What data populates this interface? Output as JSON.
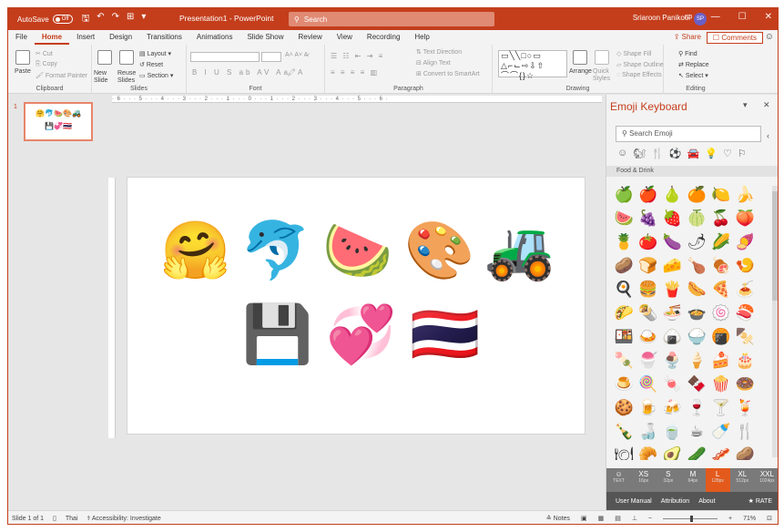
{
  "titlebar": {
    "autosave_label": "AutoSave",
    "autosave_state": "Off",
    "doc_title": "Presentation1 - PowerPoint",
    "search_placeholder": "Search",
    "user_name": "Sriaroon Panikool",
    "user_initials": "SP"
  },
  "tabs": [
    "File",
    "Home",
    "Insert",
    "Design",
    "Transitions",
    "Animations",
    "Slide Show",
    "Review",
    "View",
    "Recording",
    "Help"
  ],
  "active_tab": "Home",
  "share_label": "Share",
  "comments_label": "Comments",
  "ribbon": {
    "clipboard": {
      "label": "Clipboard",
      "paste": "Paste",
      "cut": "Cut",
      "copy": "Copy",
      "format_painter": "Format Painter"
    },
    "slides": {
      "label": "Slides",
      "new_slide": "New Slide",
      "reuse_slides": "Reuse Slides",
      "layout": "Layout",
      "reset": "Reset",
      "section": "Section"
    },
    "font": {
      "label": "Font"
    },
    "paragraph": {
      "label": "Paragraph",
      "text_direction": "Text Direction",
      "align_text": "Align Text",
      "convert_smartart": "Convert to SmartArt"
    },
    "drawing": {
      "label": "Drawing",
      "arrange": "Arrange",
      "quick_styles": "Quick Styles",
      "shape_fill": "Shape Fill",
      "shape_outline": "Shape Outline",
      "shape_effects": "Shape Effects"
    },
    "editing": {
      "label": "Editing",
      "find": "Find",
      "replace": "Replace",
      "select": "Select"
    }
  },
  "thumbnail": {
    "number": "1",
    "row1": "🤗🐬🍉🎨🚜",
    "row2": "💾💞🇹🇭"
  },
  "ruler_text": "· 6 · · · 5 · · · 4 · · · 3 · · · 2 · · · 1 · · · 0 · · · 1 · · · 2 · · · 3 · · · 4 · · · 5 · · · 6 ·",
  "slide_emojis": {
    "hugging": "🤗",
    "dolphin": "🐬",
    "watermelon": "🍉",
    "palette": "🎨",
    "tractor": "🚜",
    "floppy": "💾",
    "hearts": "💞",
    "flag": "🇹🇭"
  },
  "emoji_panel": {
    "title": "Emoji Keyboard",
    "search_placeholder": "Search Emoji",
    "category_icons": [
      "☺",
      "🐿",
      "🍴",
      "⚽",
      "🚘",
      "💡",
      "♡",
      "⚐"
    ],
    "category_label": "Food & Drink",
    "emojis": [
      "🍏",
      "🍎",
      "🍐",
      "🍊",
      "🍋",
      "🍌",
      "🍉",
      "🍇",
      "🍓",
      "🍈",
      "🍒",
      "🍑",
      "🍍",
      "🍅",
      "🍆",
      "🌶",
      "🌽",
      "🍠",
      "🥔",
      "🍞",
      "🧀",
      "🍗",
      "🍖",
      "🍤",
      "🍳",
      "🍔",
      "🍟",
      "🌭",
      "🍕",
      "🍝",
      "🌮",
      "🌯",
      "🍜",
      "🍲",
      "🍥",
      "🍣",
      "🍱",
      "🍛",
      "🍙",
      "🍚",
      "🍘",
      "🍢",
      "🍡",
      "🍧",
      "🍨",
      "🍦",
      "🍰",
      "🎂",
      "🍮",
      "🍭",
      "🍬",
      "🍫",
      "🍿",
      "🍩",
      "🍪",
      "🍺",
      "🍻",
      "🍷",
      "🍸",
      "🍹",
      "🍾",
      "🍶",
      "🍵",
      "☕",
      "🍼",
      "🍴",
      "🍽",
      "🥐",
      "🥑",
      "🥒",
      "🥓",
      "🥔"
    ],
    "sizes": [
      {
        "code": "XS",
        "px": "16px"
      },
      {
        "code": "S",
        "px": "32px"
      },
      {
        "code": "M",
        "px": "64px"
      },
      {
        "code": "L",
        "px": "128px"
      },
      {
        "code": "XL",
        "px": "512px"
      },
      {
        "code": "XXL",
        "px": "1024px"
      }
    ],
    "text_label": "TEXT",
    "selected_size": "L",
    "footer": {
      "user_manual": "User Manual",
      "attribution": "Attribution",
      "about": "About",
      "rate": "RATE"
    }
  },
  "status": {
    "slide": "Slide 1 of 1",
    "language": "Thai",
    "accessibility": "Accessibility: Investigate",
    "notes": "Notes",
    "zoom": "71%"
  }
}
